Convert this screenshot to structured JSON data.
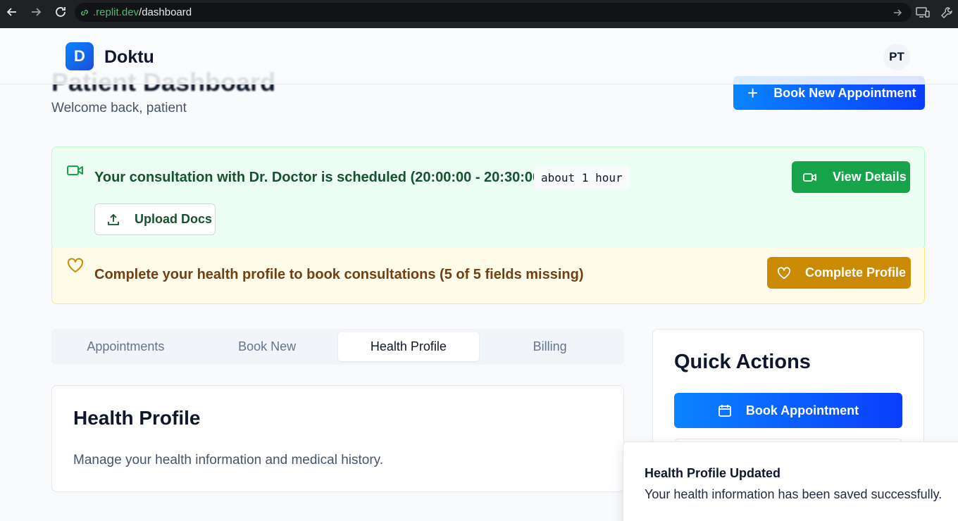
{
  "browser": {
    "url_host": ".replit.dev",
    "url_path": "/dashboard"
  },
  "header": {
    "logo_letter": "D",
    "brand": "Doktu",
    "avatar_initials": "PT"
  },
  "page": {
    "title": "Patient Dashboard",
    "welcome": "Welcome back, patient",
    "book_new_label": "Book New Appointment"
  },
  "consultation": {
    "message": "Your consultation with Dr. Doctor is scheduled (20:00:00 - 20:30:00)",
    "time_badge": "about 1 hour",
    "upload_label": "Upload Docs",
    "view_label": "View Details"
  },
  "profile_warning": {
    "message": "Complete your health profile to book consultations (5 of 5 fields missing)",
    "button_label": "Complete Profile"
  },
  "tabs": [
    {
      "label": "Appointments",
      "active": false
    },
    {
      "label": "Book New",
      "active": false
    },
    {
      "label": "Health Profile",
      "active": true
    },
    {
      "label": "Billing",
      "active": false
    }
  ],
  "health_profile": {
    "title": "Health Profile",
    "description": "Manage your health information and medical history."
  },
  "quick_actions": {
    "title": "Quick Actions",
    "book_label": "Book Appointment"
  },
  "toast": {
    "title": "Health Profile Updated",
    "description": "Your health information has been saved successfully."
  },
  "colors": {
    "primary": "#0b5cff",
    "success": "#16a34a",
    "warning": "#ca8a04"
  }
}
